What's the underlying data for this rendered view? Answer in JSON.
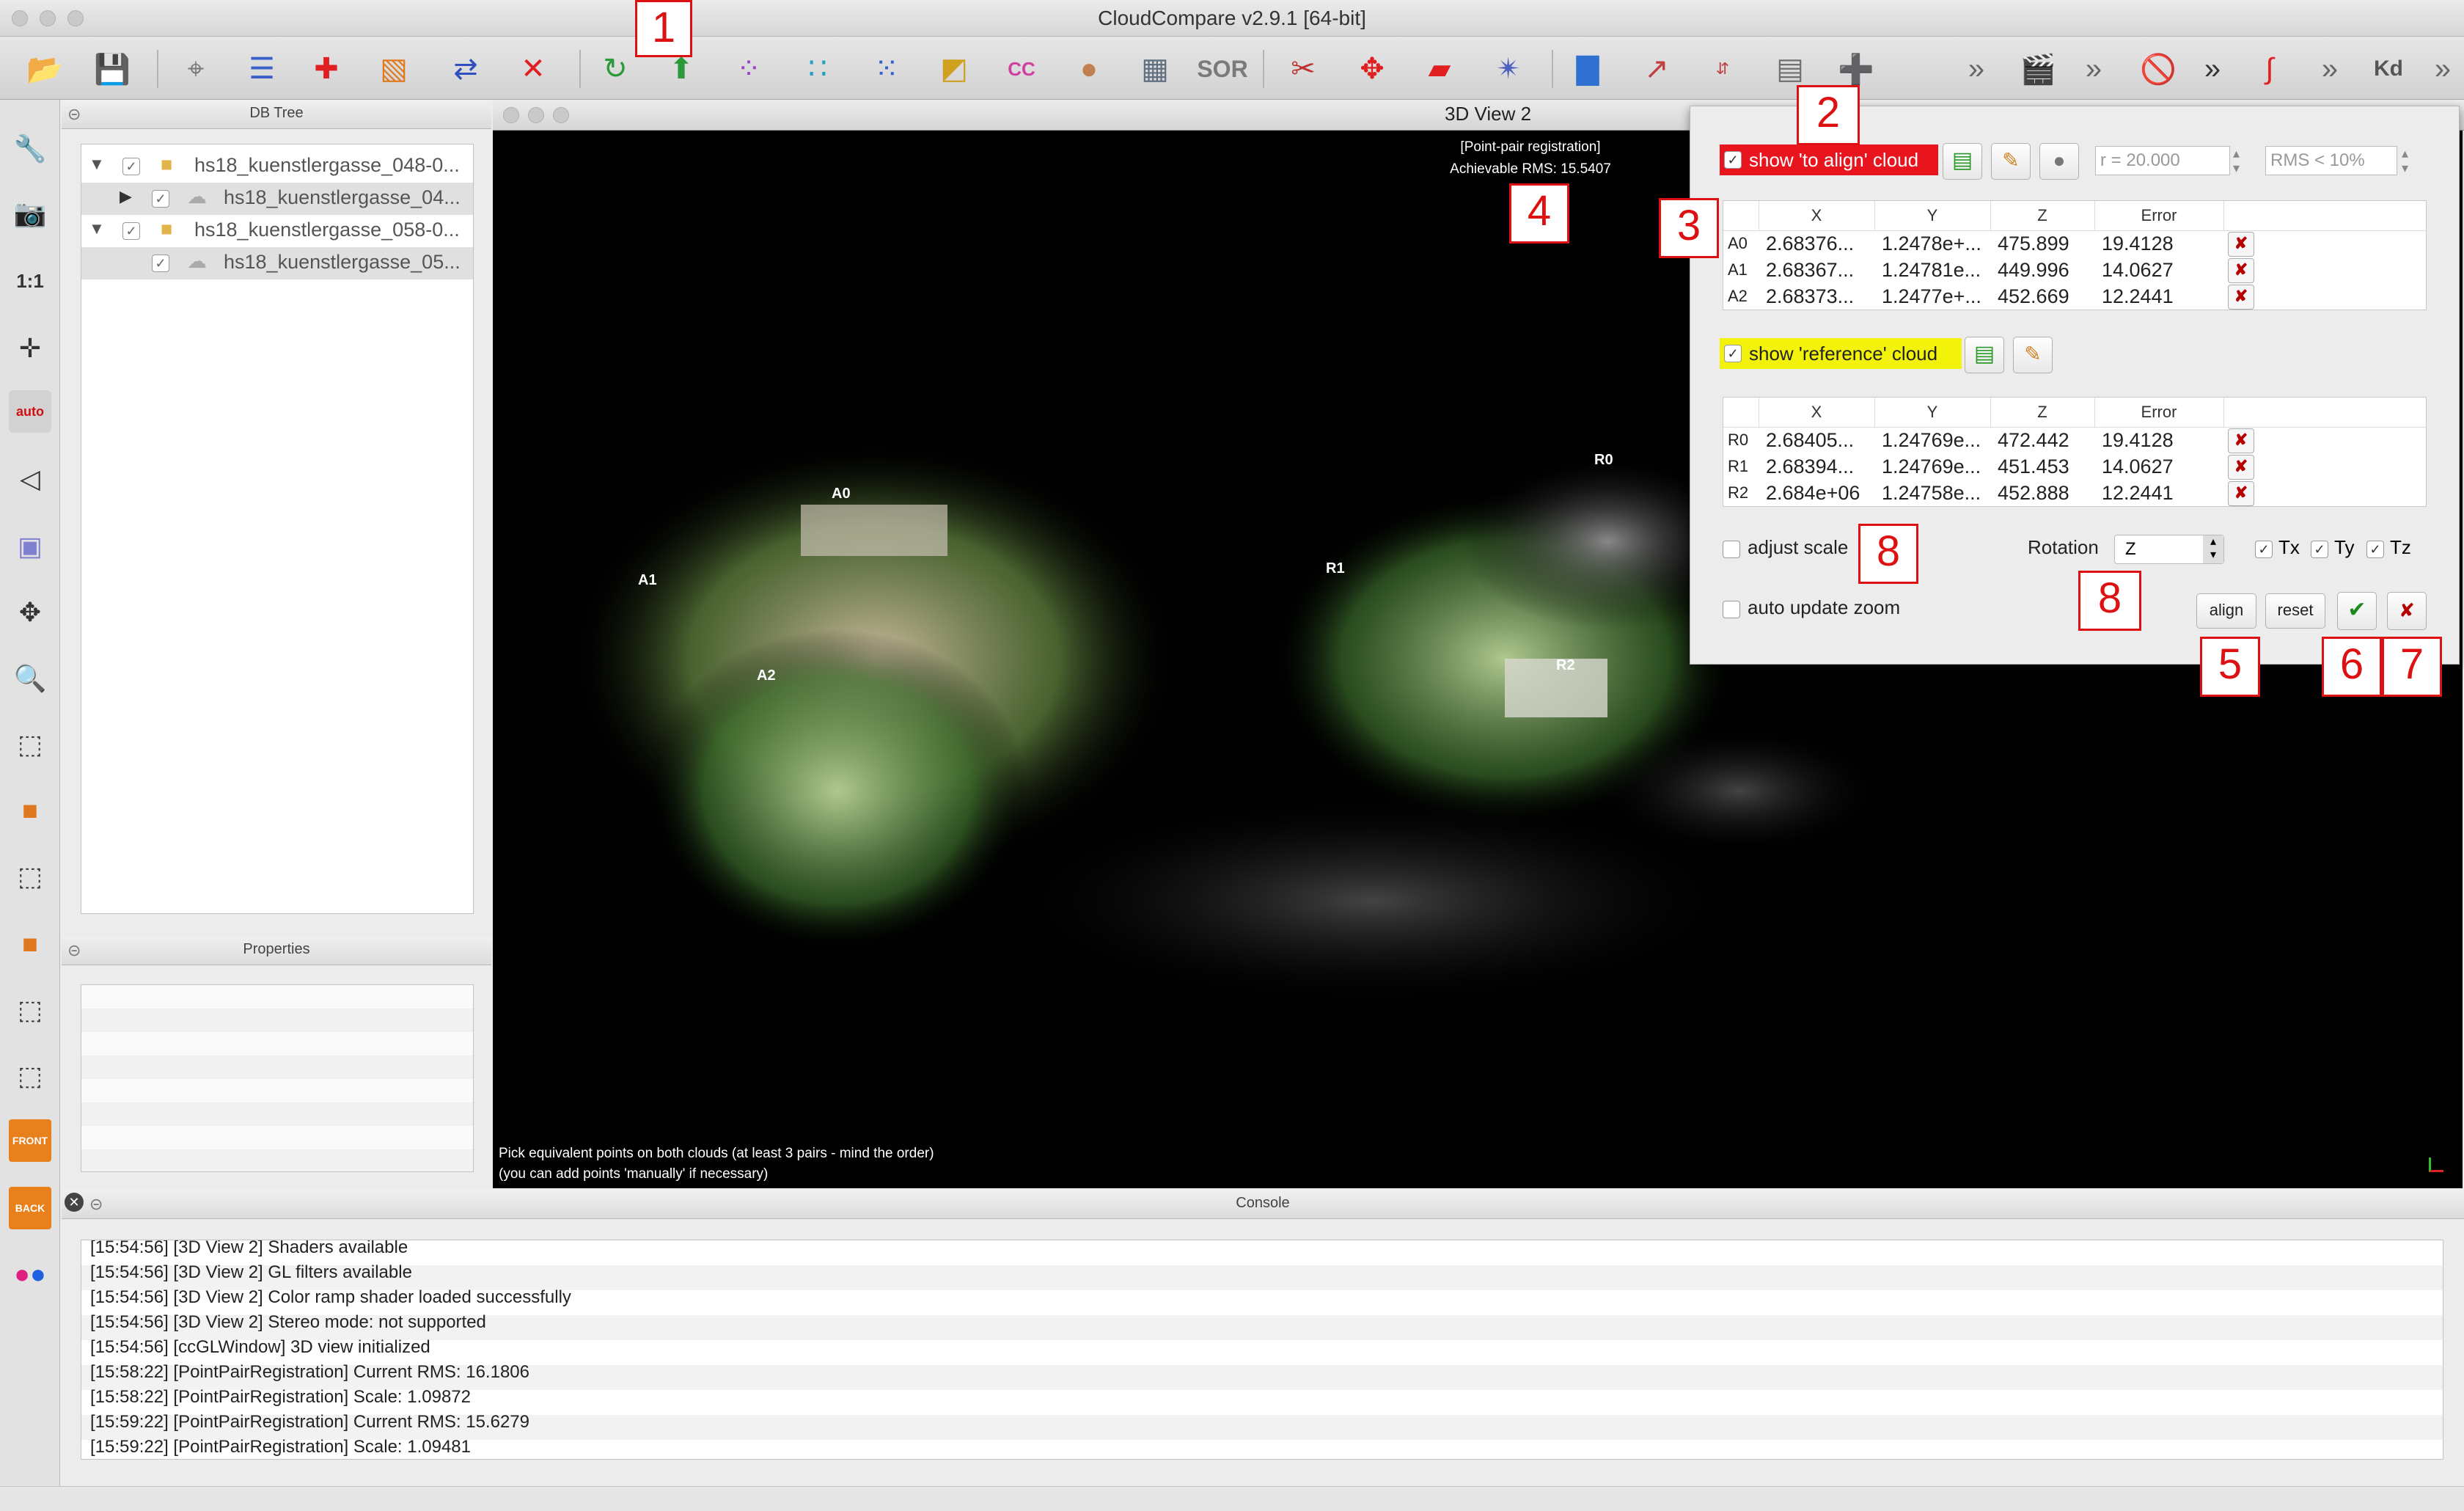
{
  "window": {
    "title": "CloudCompare v2.9.1 [64-bit]"
  },
  "toolbar": {
    "icons": [
      "open-folder-icon",
      "save-icon",
      "pick-point-icon",
      "list-icon",
      "add-point-icon",
      "color-ramp-icon",
      "merge-icon",
      "delete-icon",
      "register-icon",
      "align-icon",
      "sample-icon",
      "subsample-icon",
      "noise-icon",
      "histogram-icon",
      "compare-cc-icon",
      "smooth-icon",
      "checker-icon",
      "sor-icon",
      "cut-icon",
      "translate-icon",
      "plane-icon",
      "star-icon",
      "bar-chart-icon",
      "plot-icon",
      "minmax-icon",
      "calculator-icon",
      "plus-icon",
      "more-icon",
      "clapper-icon",
      "more-icon",
      "stop-icon",
      "more-icon",
      "curve-icon",
      "more-icon",
      "kd-icon",
      "more-icon"
    ],
    "sor_label": "SOR",
    "kd_label": "Kd"
  },
  "left_tools": {
    "one_to_one": "1:1",
    "auto": "auto",
    "front": "FRONT",
    "back": "BACK"
  },
  "db_tree": {
    "title": "DB Tree",
    "items": [
      {
        "label": "hs18_kuenstlergasse_048-0..."
      },
      {
        "label": "hs18_kuenstlergasse_04..."
      },
      {
        "label": "hs18_kuenstlergasse_058-0..."
      },
      {
        "label": "hs18_kuenstlergasse_05..."
      }
    ]
  },
  "properties": {
    "title": "Properties"
  },
  "view": {
    "title": "3D View 2",
    "overlay_title": "[Point-pair registration]",
    "overlay_rms": "Achievable RMS: 15.5407",
    "hint_line1": "Pick equivalent points on both clouds (at least 3 pairs - mind the order)",
    "hint_line2": "(you can add points 'manually' if necessary)",
    "markers": [
      "A0",
      "A1",
      "A2",
      "R0",
      "R1",
      "R2"
    ]
  },
  "registration": {
    "to_align_label": "show 'to align' cloud",
    "reference_label": "show 'reference' cloud",
    "radius": "r = 20.000",
    "rms_threshold": "RMS < 10%",
    "columns": [
      "X",
      "Y",
      "Z",
      "Error"
    ],
    "align_rows": [
      {
        "id": "A0",
        "x": "2.68376...",
        "y": "1.2478e+...",
        "z": "475.899",
        "err": "19.4128"
      },
      {
        "id": "A1",
        "x": "2.68367...",
        "y": "1.24781e...",
        "z": "449.996",
        "err": "14.0627"
      },
      {
        "id": "A2",
        "x": "2.68373...",
        "y": "1.2477e+...",
        "z": "452.669",
        "err": "12.2441"
      }
    ],
    "ref_rows": [
      {
        "id": "R0",
        "x": "2.68405...",
        "y": "1.24769e...",
        "z": "472.442",
        "err": "19.4128"
      },
      {
        "id": "R1",
        "x": "2.68394...",
        "y": "1.24769e...",
        "z": "451.453",
        "err": "14.0627"
      },
      {
        "id": "R2",
        "x": "2.684e+06",
        "y": "1.24758e...",
        "z": "452.888",
        "err": "12.2441"
      }
    ],
    "adjust_scale": "adjust scale",
    "auto_update_zoom": "auto update zoom",
    "rotation_label": "Rotation",
    "rotation_value": "Z",
    "tx": "Tx",
    "ty": "Ty",
    "tz": "Tz",
    "align_btn": "align",
    "reset_btn": "reset",
    "ok_glyph": "✔",
    "cancel_glyph": "✘"
  },
  "annotations": [
    "1",
    "2",
    "3",
    "4",
    "5",
    "6",
    "7",
    "8",
    "8"
  ],
  "console": {
    "title": "Console",
    "lines": [
      "[15:54:56] [3D View 2] Shaders available",
      "[15:54:56] [3D View 2] GL filters available",
      "[15:54:56] [3D View 2] Color ramp shader loaded successfully",
      "[15:54:56] [3D View 2] Stereo mode: not supported",
      "[15:54:56] [ccGLWindow] 3D view initialized",
      "[15:58:22] [PointPairRegistration] Current RMS: 16.1806",
      "[15:58:22] [PointPairRegistration] Scale: 1.09872",
      "[15:59:22] [PointPairRegistration] Current RMS: 15.6279",
      "[15:59:22] [PointPairRegistration] Scale: 1.09481"
    ]
  },
  "colors": {
    "to_align_highlight": "#e8141e",
    "reference_highlight": "#f2f20a",
    "annotation": "#d11111",
    "ok_green": "#1e8a1e"
  }
}
